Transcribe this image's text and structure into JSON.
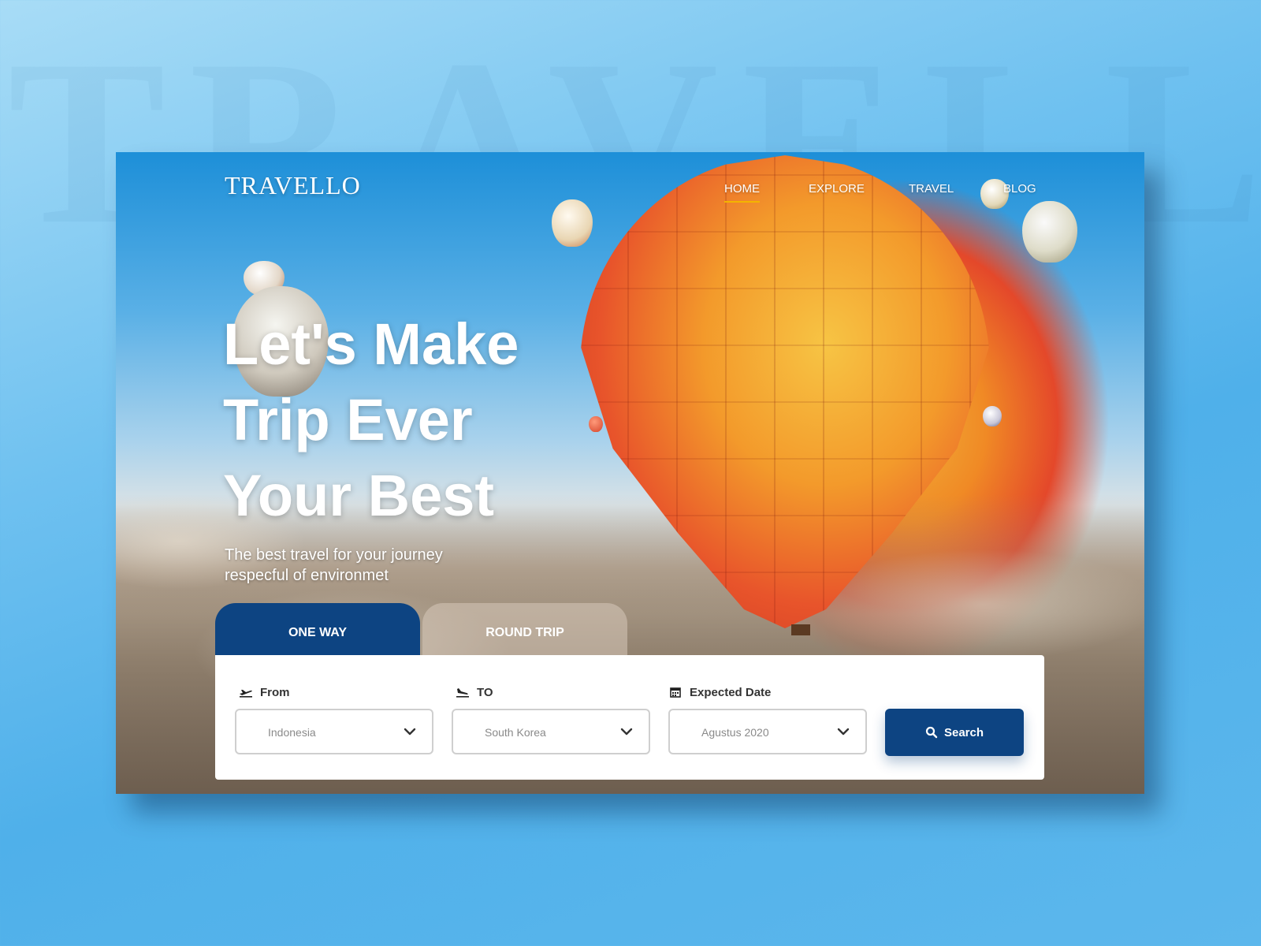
{
  "background_word": "TRAVELLO",
  "brand": {
    "logo": "TRAVELLO"
  },
  "nav": {
    "items": [
      {
        "label": "HOME",
        "active": true
      },
      {
        "label": "EXPLORE",
        "active": false
      },
      {
        "label": "TRAVEL",
        "active": false
      },
      {
        "label": "BLOG",
        "active": false
      }
    ]
  },
  "hero": {
    "headline_lines": [
      "Let's Make",
      "Trip Ever",
      "Your Best"
    ],
    "subtitle": "The best travel for your journey respecful of environmet"
  },
  "booking": {
    "tabs": [
      {
        "label": "ONE WAY",
        "active": true
      },
      {
        "label": "ROUND TRIP",
        "active": false
      }
    ],
    "fields": {
      "from": {
        "label": "From",
        "value": "Indonesia",
        "icon": "plane-departure-icon"
      },
      "to": {
        "label": "TO",
        "value": "South Korea",
        "icon": "plane-arrival-icon"
      },
      "date": {
        "label": "Expected Date",
        "value": "Agustus 2020",
        "icon": "calendar-icon"
      }
    },
    "search_label": "Search"
  },
  "colors": {
    "primary": "#0d4482",
    "nav_active_underline": "#f4b400",
    "panel": "#ffffff"
  }
}
